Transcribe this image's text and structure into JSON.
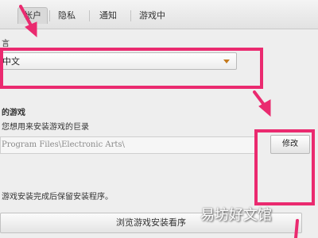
{
  "tabs": [
    {
      "label": "帐户",
      "active": true
    },
    {
      "label": "隐私",
      "active": false
    },
    {
      "label": "通知",
      "active": false
    },
    {
      "label": "游戏中",
      "active": false
    }
  ],
  "language": {
    "label": "言",
    "selected": "中文"
  },
  "install": {
    "title": "的游戏",
    "description": "您想用来安装游戏的巨录",
    "path": "Program Files\\Electronic Arts\\",
    "modify_label": "修改",
    "keep_installers_label": "游戏安装完成后保留安装程序。",
    "browse_label": "浏览游戏安装看序"
  },
  "watermark": "易坊好文馆",
  "colors": {
    "annotation": "#ea2a6f",
    "dropdown_arrow": "#c47a1e"
  }
}
